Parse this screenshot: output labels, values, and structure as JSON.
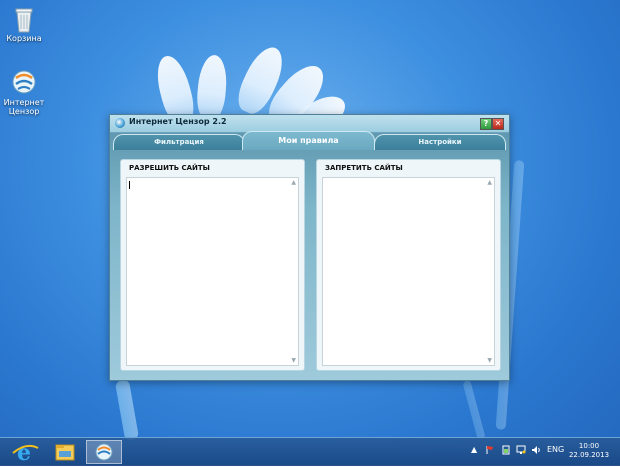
{
  "desktop": {
    "icons": [
      {
        "label": "Корзина",
        "icon": "recycle-bin-icon"
      },
      {
        "label": "Интернет Цензор",
        "icon": "internet-censor-icon"
      }
    ]
  },
  "window": {
    "title": "Интернет Цензор 2.2",
    "help_label": "?",
    "close_label": "✕",
    "tabs": [
      {
        "label": "Фильтрация",
        "active": false
      },
      {
        "label": "Мои правила",
        "active": true
      },
      {
        "label": "Настройки",
        "active": false
      }
    ],
    "panels": {
      "allow": {
        "title": "РАЗРЕШИТЬ САЙТЫ",
        "value": ""
      },
      "deny": {
        "title": "ЗАПРЕТИТЬ САЙТЫ",
        "value": ""
      }
    }
  },
  "taskbar": {
    "items": [
      {
        "icon": "internet-explorer-icon"
      },
      {
        "icon": "file-explorer-icon"
      },
      {
        "icon": "internet-censor-icon",
        "active": true
      }
    ],
    "tray": {
      "language": "ENG",
      "time": "10:00",
      "date": "22.09.2013"
    }
  },
  "colors": {
    "accent": "#3c7f9a",
    "desktop": "#2b78d0"
  }
}
